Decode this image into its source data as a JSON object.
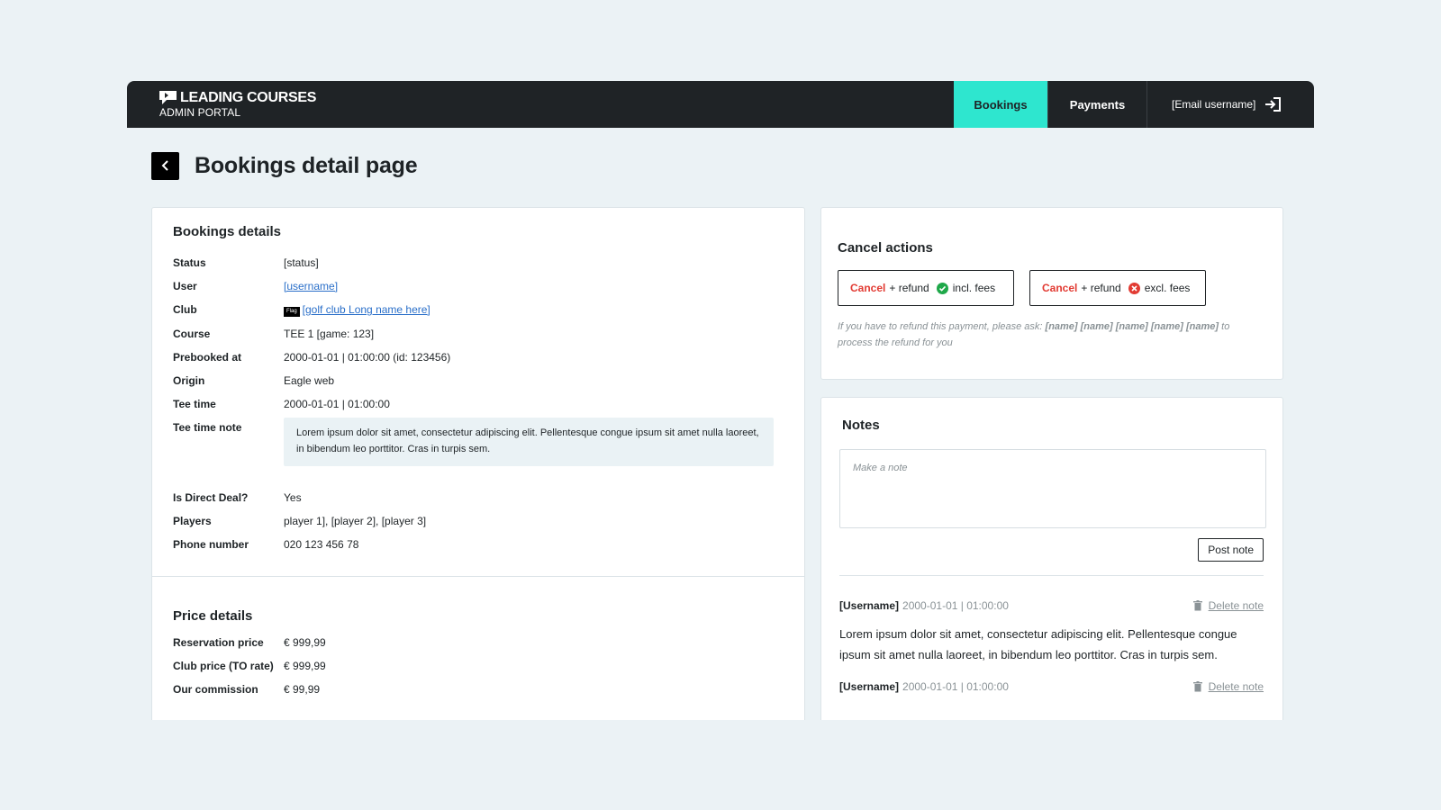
{
  "header": {
    "brand_name": "LEADING COURSES",
    "brand_sub": "ADMIN PORTAL",
    "nav": {
      "bookings": "Bookings",
      "payments": "Payments"
    },
    "user_email": "[Email username]",
    "active_color": "#2ee6cf"
  },
  "page": {
    "title": "Bookings detail page"
  },
  "booking_details": {
    "title": "Bookings details",
    "status": {
      "label": "Status",
      "value": "[status]"
    },
    "user": {
      "label": "User",
      "value": "[username]"
    },
    "club": {
      "label": "Club",
      "flag": "Flag",
      "value": "[golf club Long name here]"
    },
    "course": {
      "label": "Course",
      "value": "TEE 1 [game: 123]"
    },
    "prebooked": {
      "label": "Prebooked at",
      "value": "2000-01-01 | 01:00:00 (id: 123456)"
    },
    "origin": {
      "label": "Origin",
      "value": "Eagle web"
    },
    "tee_time": {
      "label": "Tee time",
      "value": "2000-01-01 | 01:00:00"
    },
    "tee_note": {
      "label": "Tee time note",
      "value": "Lorem ipsum dolor sit amet, consectetur adipiscing elit. Pellentesque congue ipsum sit amet nulla laoreet, in bibendum leo porttitor. Cras in turpis sem."
    },
    "direct_deal": {
      "label": "Is Direct Deal?",
      "value": "Yes"
    },
    "players": {
      "label": "Players",
      "value": "player 1], [player 2], [player 3]"
    },
    "phone": {
      "label": "Phone number",
      "value": "020 123 456 78"
    }
  },
  "price_details": {
    "title": "Price details",
    "reservation": {
      "label": "Reservation price",
      "value": "€ 999,99"
    },
    "club_price": {
      "label": "Club price (TO rate)",
      "value": "€ 999,99"
    },
    "commission": {
      "label": "Our commission",
      "value": "€ 99,99"
    }
  },
  "cancel_actions": {
    "title": "Cancel actions",
    "btn_incl": {
      "cancel": "Cancel",
      "refund": "+ refund",
      "fees": "incl. fees"
    },
    "btn_excl": {
      "cancel": "Cancel",
      "refund": "+ refund",
      "fees": "excl. fees"
    },
    "hint_prefix": "If you have to refund this payment, please ask:",
    "hint_names": "[name] [name] [name] [name] [name]",
    "hint_suffix": "to process the refund for you",
    "cancel_color": "#e23b33",
    "ok_color": "#1fa84a"
  },
  "notes": {
    "title": "Notes",
    "placeholder": "Make a note",
    "post_label": "Post note",
    "items": [
      {
        "user": "[Username]",
        "time": "2000-01-01 | 01:00:00",
        "delete_label": "Delete note",
        "body": "Lorem ipsum dolor sit amet, consectetur adipiscing elit. Pellentesque congue ipsum sit amet nulla laoreet, in bibendum leo porttitor. Cras in turpis sem."
      },
      {
        "user": "[Username]",
        "time": "2000-01-01 | 01:00:00",
        "delete_label": "Delete note",
        "body": ""
      }
    ]
  }
}
